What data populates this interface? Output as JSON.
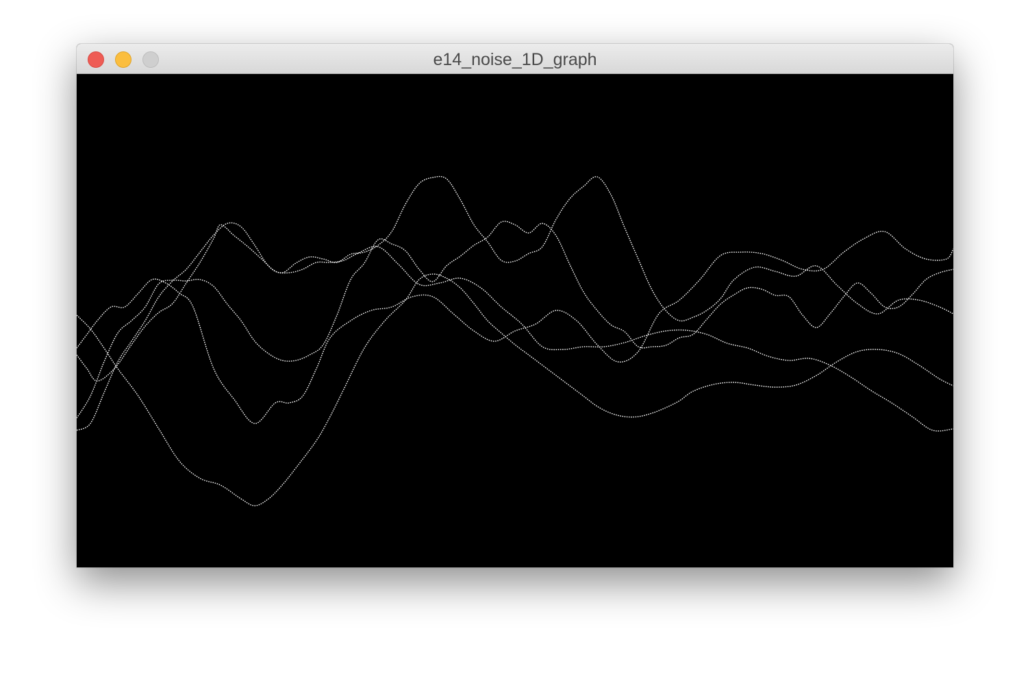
{
  "window": {
    "title": "e14_noise_1D_graph",
    "background_color": "#000000",
    "stroke_color": "#ffffff"
  },
  "controls": {
    "close_icon": "red-circle",
    "minimize_icon": "yellow-circle",
    "zoom_icon": "gray-circle"
  },
  "chart_data": {
    "type": "line",
    "xlim": [
      0,
      1280
    ],
    "ylim": [
      0,
      720
    ],
    "grid": false,
    "series": [
      {
        "x": [
          0,
          20,
          40,
          60,
          90,
          120,
          150,
          180,
          210,
          240,
          260,
          280,
          300,
          320,
          350,
          370,
          390,
          420,
          450,
          480,
          500,
          520,
          540,
          560,
          580,
          600,
          620,
          640,
          660,
          680,
          700,
          720,
          740,
          760,
          780,
          800,
          820,
          840,
          860,
          880,
          900,
          930,
          960,
          990,
          1020,
          1050,
          1080,
          1110,
          1140,
          1170,
          1200,
          1230,
          1260,
          1280
        ],
        "y": [
          352,
          372,
          400,
          430,
          470,
          518,
          565,
          590,
          600,
          620,
          630,
          620,
          600,
          575,
          535,
          500,
          460,
          400,
          360,
          330,
          300,
          292,
          298,
          312,
          335,
          360,
          378,
          395,
          410,
          425,
          440,
          455,
          470,
          485,
          495,
          500,
          500,
          495,
          487,
          477,
          463,
          453,
          450,
          454,
          457,
          454,
          440,
          420,
          405,
          402,
          408,
          425,
          445,
          455
        ]
      },
      {
        "x": [
          0,
          15,
          30,
          55,
          80,
          100,
          120,
          140,
          160,
          180,
          200,
          210,
          230,
          250,
          270,
          290,
          310,
          330,
          350,
          370,
          390,
          410,
          440,
          470,
          500,
          530,
          560,
          590,
          620,
          650,
          680,
          710,
          740,
          770,
          800,
          830,
          860,
          890,
          920,
          950,
          980,
          1010,
          1040,
          1070,
          1100,
          1130,
          1160,
          1190,
          1220,
          1250,
          1280
        ],
        "y": [
          410,
          430,
          448,
          430,
          395,
          368,
          348,
          335,
          305,
          275,
          240,
          220,
          236,
          252,
          270,
          288,
          290,
          285,
          275,
          275,
          272,
          262,
          252,
          278,
          307,
          305,
          298,
          312,
          340,
          365,
          398,
          402,
          398,
          398,
          392,
          382,
          375,
          374,
          380,
          393,
          400,
          412,
          418,
          415,
          425,
          442,
          462,
          480,
          500,
          520,
          518
        ]
      },
      {
        "x": [
          0,
          20,
          40,
          60,
          80,
          100,
          120,
          140,
          160,
          180,
          200,
          220,
          240,
          260,
          280,
          300,
          320,
          340,
          360,
          380,
          400,
          420,
          440,
          460,
          480,
          500,
          520,
          540,
          560,
          580,
          600,
          620,
          640,
          660,
          680,
          700,
          720,
          740,
          760,
          780,
          800,
          820,
          840,
          860,
          880,
          900,
          920,
          940,
          960,
          990,
          1020,
          1050,
          1080,
          1110,
          1140,
          1170,
          1200,
          1230,
          1260,
          1280
        ],
        "y": [
          520,
          510,
          465,
          420,
          390,
          360,
          325,
          302,
          285,
          260,
          235,
          218,
          223,
          250,
          280,
          290,
          276,
          267,
          270,
          275,
          263,
          260,
          250,
          230,
          190,
          160,
          151,
          153,
          183,
          220,
          245,
          272,
          273,
          262,
          252,
          212,
          182,
          164,
          150,
          176,
          224,
          270,
          315,
          345,
          360,
          355,
          345,
          328,
          300,
          282,
          288,
          295,
          280,
          308,
          335,
          350,
          330,
          330,
          340,
          350
        ]
      },
      {
        "x": [
          0,
          15,
          30,
          50,
          70,
          90,
          110,
          130,
          150,
          170,
          200,
          230,
          260,
          290,
          310,
          330,
          350,
          370,
          400,
          430,
          460,
          490,
          520,
          550,
          580,
          610,
          640,
          670,
          700,
          730,
          760,
          790,
          820,
          850,
          880,
          910,
          940,
          970,
          1000,
          1030,
          1060,
          1090,
          1120,
          1150,
          1180,
          1210,
          1240,
          1270,
          1280
        ],
        "y": [
          400,
          380,
          360,
          340,
          340,
          320,
          300,
          305,
          320,
          340,
          430,
          475,
          510,
          480,
          480,
          470,
          430,
          385,
          360,
          345,
          340,
          325,
          325,
          350,
          375,
          390,
          375,
          365,
          345,
          360,
          395,
          420,
          405,
          350,
          330,
          300,
          265,
          260,
          262,
          272,
          285,
          285,
          260,
          240,
          230,
          255,
          270,
          270,
          255
        ]
      },
      {
        "x": [
          0,
          20,
          40,
          60,
          80,
          100,
          120,
          140,
          160,
          180,
          200,
          220,
          240,
          260,
          280,
          300,
          320,
          340,
          360,
          380,
          400,
          420,
          440,
          460,
          480,
          500,
          520,
          540,
          560,
          580,
          600,
          620,
          640,
          660,
          680,
          700,
          720,
          740,
          760,
          780,
          800,
          820,
          840,
          860,
          880,
          900,
          920,
          940,
          960,
          980,
          1000,
          1020,
          1040,
          1060,
          1080,
          1100,
          1120,
          1140,
          1160,
          1180,
          1200,
          1220,
          1240,
          1260,
          1280
        ],
        "y": [
          502,
          470,
          420,
          378,
          360,
          340,
          306,
          301,
          302,
          300,
          310,
          336,
          360,
          390,
          408,
          418,
          418,
          410,
          395,
          352,
          300,
          276,
          242,
          248,
          258,
          285,
          303,
          280,
          266,
          250,
          238,
          216,
          220,
          232,
          218,
          236,
          278,
          318,
          345,
          366,
          376,
          398,
          398,
          396,
          385,
          380,
          358,
          336,
          322,
          312,
          314,
          323,
          325,
          352,
          370,
          350,
          325,
          305,
          320,
          340,
          340,
          322,
          300,
          290,
          285
        ]
      }
    ]
  }
}
